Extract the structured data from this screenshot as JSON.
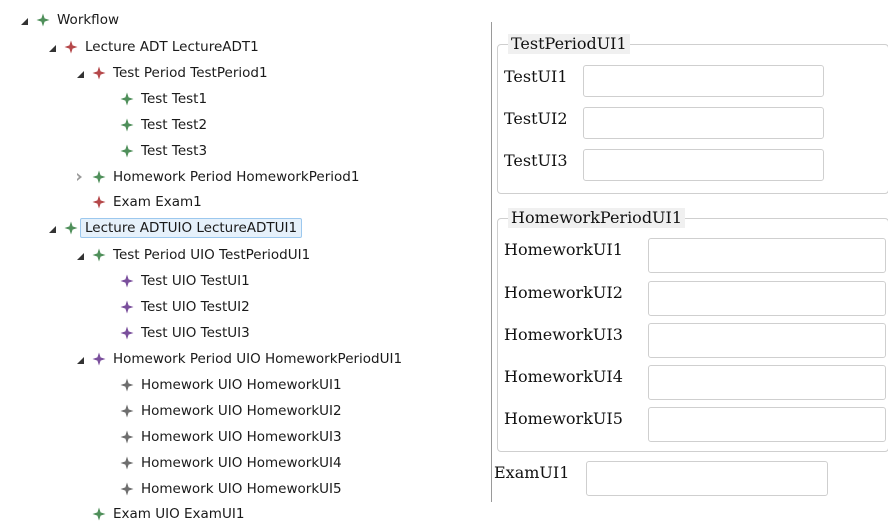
{
  "tree": {
    "root": "Workflow",
    "lecture_adt": "Lecture ADT LectureADT1",
    "test_period": "Test Period TestPeriod1",
    "test1": "Test Test1",
    "test2": "Test Test2",
    "test3": "Test Test3",
    "homework_period": "Homework Period HomeworkPeriod1",
    "exam": "Exam Exam1",
    "lecture_uio": "Lecture ADTUIO LectureADTUI1",
    "test_period_uio": "Test Period UIO TestPeriodUI1",
    "test_uio1": "Test UIO TestUI1",
    "test_uio2": "Test UIO TestUI2",
    "test_uio3": "Test UIO TestUI3",
    "homework_period_uio": "Homework Period UIO HomeworkPeriodUI1",
    "hw_uio1": "Homework UIO HomeworkUI1",
    "hw_uio2": "Homework UIO HomeworkUI2",
    "hw_uio3": "Homework UIO HomeworkUI3",
    "hw_uio4": "Homework UIO HomeworkUI4",
    "hw_uio5": "Homework UIO HomeworkUI5",
    "exam_uio": "Exam UIO ExamUI1"
  },
  "form": {
    "test_group_title": "TestPeriodUI1",
    "test_labels": [
      "TestUI1",
      "TestUI2",
      "TestUI3"
    ],
    "homework_group_title": "HomeworkPeriodUI1",
    "homework_labels": [
      "HomeworkUI1",
      "HomeworkUI2",
      "HomeworkUI3",
      "HomeworkUI4",
      "HomeworkUI5"
    ],
    "exam_label": "ExamUI1"
  },
  "colors": {
    "green_icon": "#4f8f5a",
    "red_icon": "#b5484a",
    "purple_icon": "#7a4f9c",
    "gray_icon": "#6e6e6e",
    "selection_bg": "#e6f1fb",
    "selection_border": "#9cc8ee"
  },
  "icons": {
    "node": "four-point-star-icon",
    "expand": "triangle-expanded-icon",
    "collapse": "triangle-collapsed-icon"
  }
}
